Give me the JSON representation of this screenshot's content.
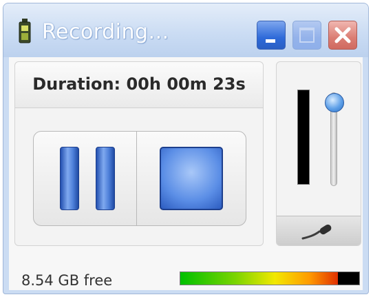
{
  "window": {
    "title": "Recording...",
    "icon": "recorder-app-icon",
    "controls": {
      "minimize": "minimize-icon",
      "maximize": "maximize-icon",
      "close": "close-icon"
    }
  },
  "recording": {
    "duration_label": "Duration: 00h 00m 23s",
    "pause_icon": "pause-icon",
    "stop_icon": "stop-icon"
  },
  "volume": {
    "level_fraction": 0.95,
    "input_level_fraction": 0.0,
    "mic_icon": "microphone-icon"
  },
  "disk": {
    "free_label": "8.54 GB free",
    "used_fraction": 0.88
  },
  "colors": {
    "titlebar": "#c9dbf3",
    "minimize": "#2e6ad9",
    "close": "#db7d73",
    "button_blue": "#4d7fd9"
  }
}
